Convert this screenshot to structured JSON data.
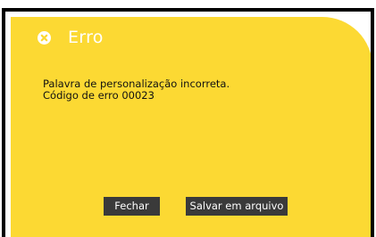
{
  "dialog": {
    "title": "Erro",
    "icon": "close-icon",
    "message_line1": "Palavra de personalização incorreta.",
    "message_line2": "Código de erro 00023",
    "buttons": {
      "close_label": "Fechar",
      "save_label": "Salvar em arquivo"
    }
  },
  "colors": {
    "panel": "#fcd933",
    "button": "#3a3a3a",
    "title": "#ffffff",
    "frame": "#000000"
  }
}
